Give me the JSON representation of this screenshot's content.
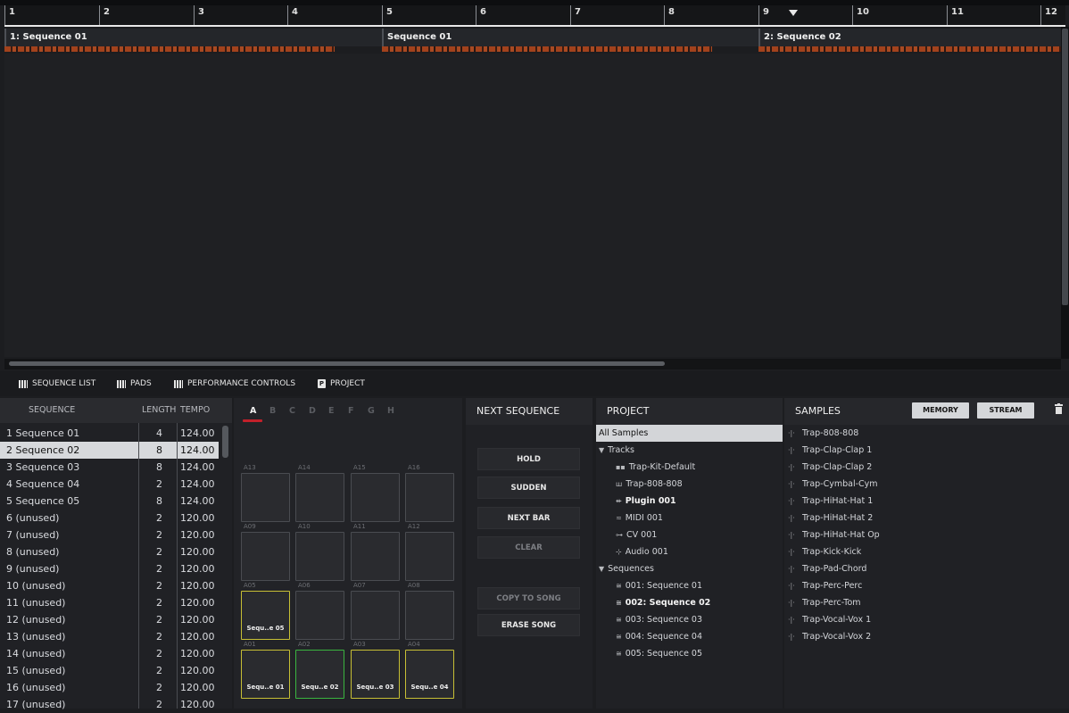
{
  "timeline": {
    "bars": [
      "1",
      "2",
      "3",
      "4",
      "5",
      "6",
      "7",
      "8",
      "9",
      "10",
      "11",
      "12"
    ],
    "blocks": [
      "1: Sequence 01",
      "Sequence 01",
      "2: Sequence 02"
    ]
  },
  "tabs": {
    "sequence_list": "SEQUENCE LIST",
    "pads": "PADS",
    "performance_controls": "PERFORMANCE CONTROLS",
    "project": "PROJECT",
    "project_icon_letter": "P"
  },
  "sequence_list": {
    "headers": {
      "sequence": "SEQUENCE",
      "length": "LENGTH",
      "tempo": "TEMPO"
    },
    "rows": [
      {
        "name": "1  Sequence 01",
        "length": "4",
        "tempo": "124.00"
      },
      {
        "name": "2  Sequence 02",
        "length": "8",
        "tempo": "124.00"
      },
      {
        "name": "3  Sequence 03",
        "length": "8",
        "tempo": "124.00"
      },
      {
        "name": "4  Sequence 04",
        "length": "2",
        "tempo": "124.00"
      },
      {
        "name": "5  Sequence 05",
        "length": "8",
        "tempo": "124.00"
      },
      {
        "name": "6  (unused)",
        "length": "2",
        "tempo": "120.00"
      },
      {
        "name": "7  (unused)",
        "length": "2",
        "tempo": "120.00"
      },
      {
        "name": "8  (unused)",
        "length": "2",
        "tempo": "120.00"
      },
      {
        "name": "9  (unused)",
        "length": "2",
        "tempo": "120.00"
      },
      {
        "name": "10 (unused)",
        "length": "2",
        "tempo": "120.00"
      },
      {
        "name": "11  (unused)",
        "length": "2",
        "tempo": "120.00"
      },
      {
        "name": "12 (unused)",
        "length": "2",
        "tempo": "120.00"
      },
      {
        "name": "13 (unused)",
        "length": "2",
        "tempo": "120.00"
      },
      {
        "name": "14 (unused)",
        "length": "2",
        "tempo": "120.00"
      },
      {
        "name": "15 (unused)",
        "length": "2",
        "tempo": "120.00"
      },
      {
        "name": "16 (unused)",
        "length": "2",
        "tempo": "120.00"
      },
      {
        "name": "17 (unused)",
        "length": "2",
        "tempo": "120.00"
      }
    ],
    "selected_index": 1
  },
  "pads": {
    "banks": [
      "A",
      "B",
      "C",
      "D",
      "E",
      "F",
      "G",
      "H"
    ],
    "active_bank": "A",
    "rows": [
      [
        {
          "label": "A13",
          "text": ""
        },
        {
          "label": "A14",
          "text": ""
        },
        {
          "label": "A15",
          "text": ""
        },
        {
          "label": "A16",
          "text": ""
        }
      ],
      [
        {
          "label": "A09",
          "text": ""
        },
        {
          "label": "A10",
          "text": ""
        },
        {
          "label": "A11",
          "text": ""
        },
        {
          "label": "A12",
          "text": ""
        }
      ],
      [
        {
          "label": "A05",
          "text": "Sequ..e 05"
        },
        {
          "label": "A06",
          "text": ""
        },
        {
          "label": "A07",
          "text": ""
        },
        {
          "label": "A08",
          "text": ""
        }
      ],
      [
        {
          "label": "A01",
          "text": "Sequ..e 01"
        },
        {
          "label": "A02",
          "text": "Sequ..e 02"
        },
        {
          "label": "A03",
          "text": "Sequ..e 03"
        },
        {
          "label": "A04",
          "text": "Sequ..e 04"
        }
      ]
    ],
    "colors": {
      "assigned": "#c7bf35",
      "playing": "#3ab53f"
    }
  },
  "next_sequence": {
    "title": "NEXT SEQUENCE",
    "hold": "HOLD",
    "sudden": "SUDDEN",
    "next_bar": "NEXT BAR",
    "clear": "CLEAR",
    "copy_to_song": "COPY TO SONG",
    "erase_song": "ERASE SONG"
  },
  "project": {
    "title": "PROJECT",
    "items": [
      {
        "text": "All Samples",
        "icon": "",
        "indent": 0,
        "selected": true
      },
      {
        "text": "Tracks",
        "icon": "▼",
        "indent": 0
      },
      {
        "text": "Trap-Kit-Default",
        "icon": "▪▪",
        "indent": 2
      },
      {
        "text": "Trap-808-808",
        "icon": "ш",
        "indent": 2
      },
      {
        "text": "Plugin 001",
        "icon": "⇷",
        "indent": 2,
        "bold": true
      },
      {
        "text": "MIDI 001",
        "icon": "≂",
        "indent": 2
      },
      {
        "text": "CV 001",
        "icon": "⊶",
        "indent": 2
      },
      {
        "text": "Audio 001",
        "icon": "⊹",
        "indent": 2
      },
      {
        "text": "Sequences",
        "icon": "▼",
        "indent": 0
      },
      {
        "text": "001: Sequence 01",
        "icon": "≅",
        "indent": 2
      },
      {
        "text": "002: Sequence 02",
        "icon": "≅",
        "indent": 2,
        "bold": true
      },
      {
        "text": "003: Sequence 03",
        "icon": "≅",
        "indent": 2
      },
      {
        "text": "004: Sequence 04",
        "icon": "≅",
        "indent": 2
      },
      {
        "text": "005: Sequence 05",
        "icon": "≅",
        "indent": 2
      }
    ]
  },
  "samples": {
    "title": "SAMPLES",
    "memory": "MEMORY",
    "stream": "STREAM",
    "items": [
      "Trap-808-808",
      "Trap-Clap-Clap 1",
      "Trap-Clap-Clap 2",
      "Trap-Cymbal-Cym",
      "Trap-HiHat-Hat 1",
      "Trap-HiHat-Hat 2",
      "Trap-HiHat-Hat Op",
      "Trap-Kick-Kick",
      "Trap-Pad-Chord",
      "Trap-Perc-Perc",
      "Trap-Perc-Tom",
      "Trap-Vocal-Vox 1",
      "Trap-Vocal-Vox 2"
    ]
  }
}
